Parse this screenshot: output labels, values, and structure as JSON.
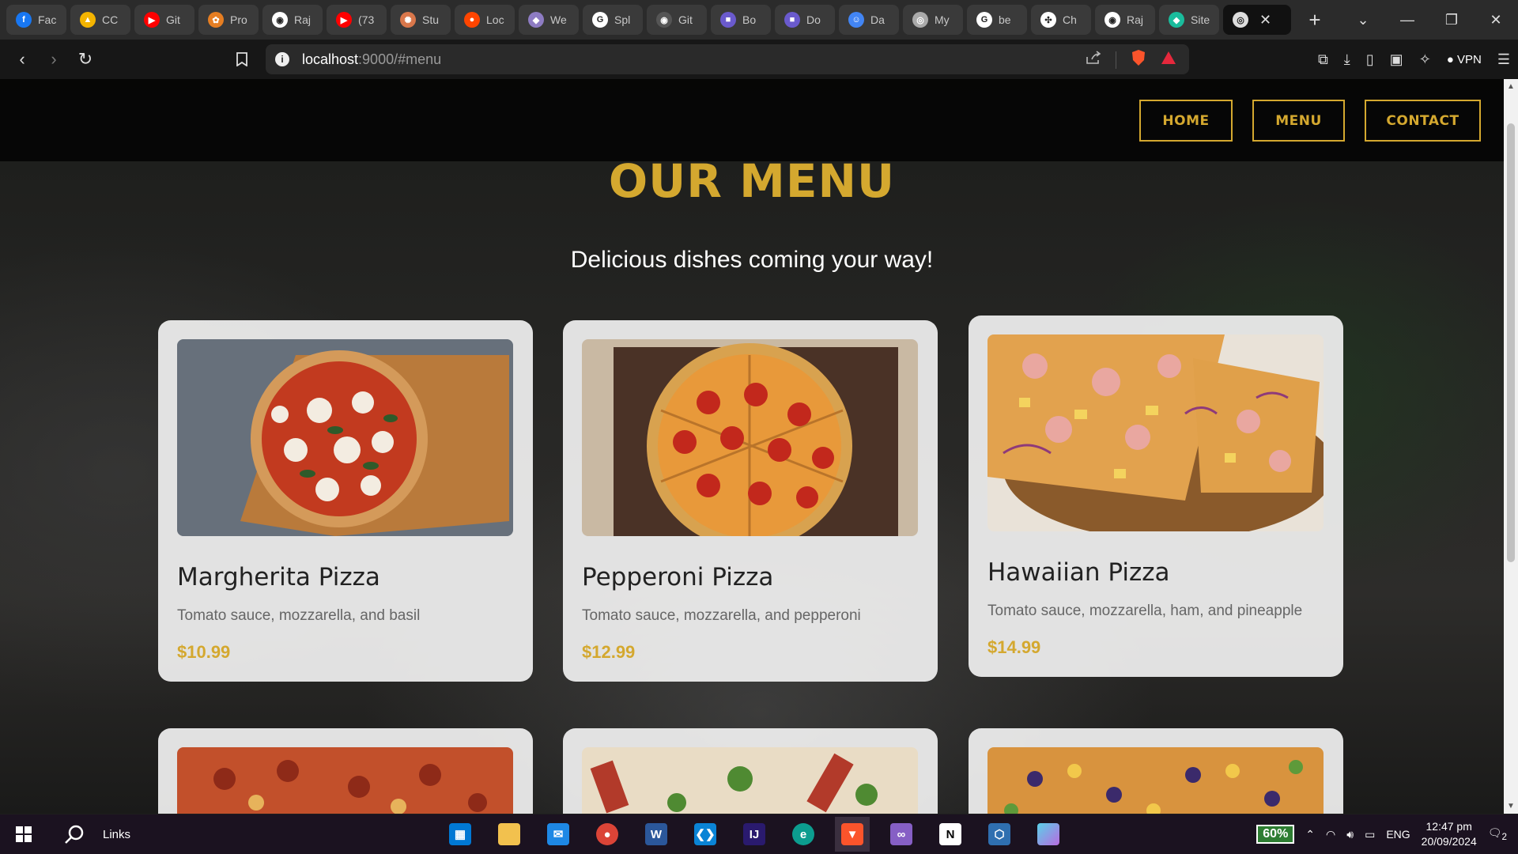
{
  "browser": {
    "tabs": [
      {
        "label": "Fac",
        "icon": "facebook-icon",
        "color": "#1877f2",
        "glyph": "f"
      },
      {
        "label": "CC",
        "icon": "google-drive-icon",
        "color": "#f4b400",
        "glyph": "▲"
      },
      {
        "label": "Git",
        "icon": "youtube-icon",
        "color": "#ff0000",
        "glyph": "▶"
      },
      {
        "label": "Pro",
        "icon": "fox-icon",
        "color": "#e67e22",
        "glyph": "✿"
      },
      {
        "label": "Raj",
        "icon": "github-icon",
        "color": "#ffffff",
        "glyph": "◉"
      },
      {
        "label": "(73",
        "icon": "youtube-icon",
        "color": "#ff0000",
        "glyph": "▶"
      },
      {
        "label": "Stu",
        "icon": "claude-icon",
        "color": "#d9774b",
        "glyph": "✺"
      },
      {
        "label": "Loc",
        "icon": "reddit-icon",
        "color": "#ff4500",
        "glyph": "●"
      },
      {
        "label": "We",
        "icon": "chat-icon",
        "color": "#8e7cc3",
        "glyph": "◆"
      },
      {
        "label": "Spl",
        "icon": "google-icon",
        "color": "#ffffff",
        "glyph": "G"
      },
      {
        "label": "Git",
        "icon": "github-icon",
        "color": "#555555",
        "glyph": "◉"
      },
      {
        "label": "Bo",
        "icon": "app-icon",
        "color": "#6a5acd",
        "glyph": "■"
      },
      {
        "label": "Do",
        "icon": "app-icon",
        "color": "#6a5acd",
        "glyph": "■"
      },
      {
        "label": "Da",
        "icon": "contacts-icon",
        "color": "#4285f4",
        "glyph": "☺"
      },
      {
        "label": "My",
        "icon": "globe-icon",
        "color": "#aaaaaa",
        "glyph": "◎"
      },
      {
        "label": "be",
        "icon": "google-icon",
        "color": "#ffffff",
        "glyph": "G"
      },
      {
        "label": "Ch",
        "icon": "openai-icon",
        "color": "#ffffff",
        "glyph": "✣"
      },
      {
        "label": "Raj",
        "icon": "github-icon",
        "color": "#ffffff",
        "glyph": "◉"
      },
      {
        "label": "Site",
        "icon": "site-icon",
        "color": "#1abc9c",
        "glyph": "◆"
      }
    ],
    "active_tab_close": "✕",
    "new_tab": "+",
    "url_host": "localhost",
    "url_path": ":9000/#menu",
    "vpn_label": "VPN"
  },
  "site": {
    "nav": [
      "HOME",
      "MENU",
      "CONTACT"
    ],
    "title": "OUR MENU",
    "subtitle": "Delicious dishes coming your way!",
    "dishes": [
      {
        "name": "Margherita Pizza",
        "desc": "Tomato sauce, mozzarella, and basil",
        "price": "$10.99"
      },
      {
        "name": "Pepperoni Pizza",
        "desc": "Tomato sauce, mozzarella, and pepperoni",
        "price": "$12.99"
      },
      {
        "name": "Hawaiian Pizza",
        "desc": "Tomato sauce, mozzarella, ham, and pineapple",
        "price": "$14.99"
      }
    ]
  },
  "taskbar": {
    "search_label": "Links",
    "battery": "60%",
    "language": "ENG",
    "time": "12:47 pm",
    "date": "20/09/2024",
    "notifications": "2"
  },
  "colors": {
    "accent_gold": "#d4a82f",
    "card_bg": "#f0f0f0"
  }
}
